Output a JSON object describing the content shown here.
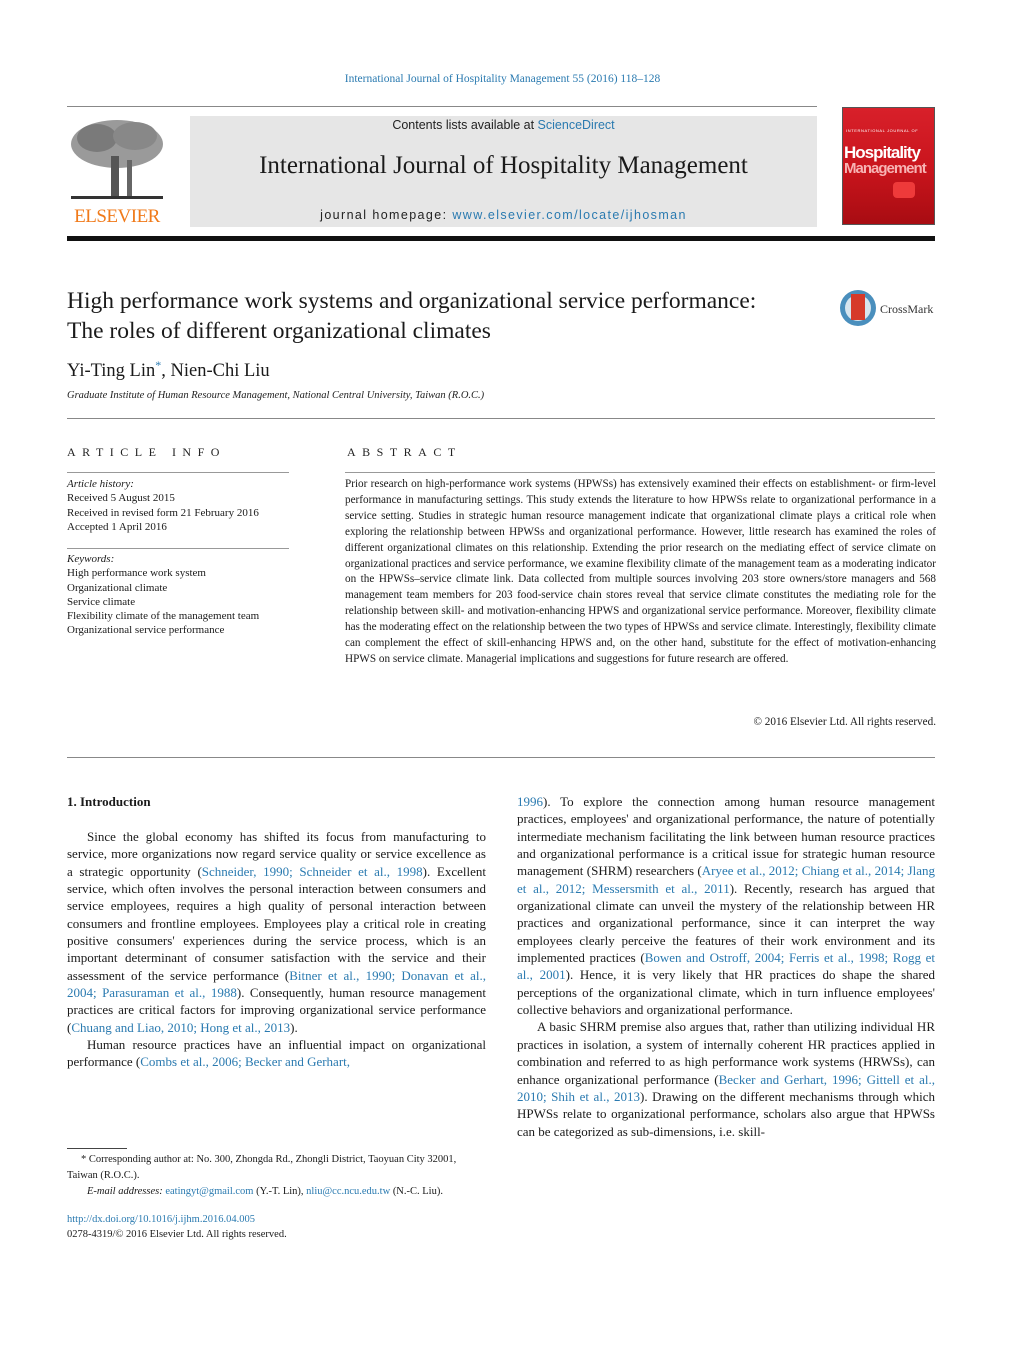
{
  "header": {
    "running_head": "International Journal of Hospitality Management 55 (2016) 118–128",
    "publisher_logo_text": "ELSEVIER",
    "contents_prefix": "Contents lists available at ",
    "contents_link": "ScienceDirect",
    "journal_title": "International Journal of Hospitality Management",
    "homepage_prefix": "journal homepage: ",
    "homepage_link": "www.elsevier.com/locate/ijhosman",
    "cover": {
      "top_line": "INTERNATIONAL JOURNAL OF",
      "word1": "Hospitality",
      "word2": "Management"
    },
    "colors": {
      "link": "#2a7ab0",
      "elsevier_orange": "#f07a1a",
      "cover_red": "#c8141c"
    }
  },
  "article": {
    "title": "High performance work systems and organizational service performance: The roles of different organizational climates",
    "crossmark_label": "CrossMark",
    "authors": [
      {
        "name": "Yi-Ting Lin",
        "marker": "*"
      },
      {
        "name": "Nien-Chi Liu",
        "marker": ""
      }
    ],
    "author_sep": ", ",
    "affiliation": "Graduate Institute of Human Resource Management, National Central University, Taiwan (R.O.C.)"
  },
  "article_info": {
    "heading": "ARTICLE INFO",
    "history_label": "Article history:",
    "history": [
      "Received 5 August 2015",
      "Received in revised form 21 February 2016",
      "Accepted 1 April 2016"
    ],
    "keywords_label": "Keywords:",
    "keywords": [
      "High performance work system",
      "Organizational climate",
      "Service climate",
      "Flexibility climate of the management team",
      "Organizational service performance"
    ]
  },
  "abstract": {
    "heading": "ABSTRACT",
    "text": "Prior research on high-performance work systems (HPWSs) has extensively examined their effects on establishment- or firm-level performance in manufacturing settings. This study extends the literature to how HPWSs relate to organizational performance in a service setting. Studies in strategic human resource management indicate that organizational climate plays a critical role when exploring the relationship between HPWSs and organizational performance. However, little research has examined the roles of different organizational climates on this relationship. Extending the prior research on the mediating effect of service climate on organizational practices and service performance, we examine flexibility climate of the management team as a moderating indicator on the HPWSs–service climate link. Data collected from multiple sources involving 203 store owners/store managers and 568 management team members for 203 food-service chain stores reveal that service climate constitutes the mediating role for the relationship between skill- and motivation-enhancing HPWS and organizational service performance. Moreover, flexibility climate has the moderating effect on the relationship between the two types of HPWSs and service climate. Interestingly, flexibility climate can complement the effect of skill-enhancing HPWS and, on the other hand, substitute for the effect of motivation-enhancing HPWS on service climate. Managerial implications and suggestions for future research are offered.",
    "copyright": "© 2016 Elsevier Ltd. All rights reserved."
  },
  "body": {
    "section_heading": "1.  Introduction",
    "left": {
      "p1": [
        "Since the global economy has shifted its focus from manufacturing to service, more organizations now regard service quality or service excellence as a strategic opportunity (",
        "Schneider, 1990; Schneider et al., 1998",
        "). Excellent service, which often involves the personal interaction between consumers and service employees, requires a high quality of personal interaction between consumers and frontline employees. Employees play a critical role in creating positive consumers' experiences during the service process, which is an important determinant of consumer satisfaction with the service and their assessment of the service performance (",
        "Bitner et al., 1990; Donavan et al., 2004; Parasuraman et al., 1988",
        "). Consequently, human resource management practices are critical factors for improving organizational service performance (",
        "Chuang and Liao, 2010; Hong et al., 2013",
        ")."
      ],
      "p2": [
        "Human resource practices have an influential impact on organizational performance (",
        "Combs et al., 2006; Becker and Gerhart,"
      ]
    },
    "right": {
      "p1": [
        "1996",
        "). To explore the connection among human resource management practices, employees' and organizational performance, the nature of potentially intermediate mechanism facilitating the link between human resource practices and organizational performance is a critical issue for strategic human resource management (SHRM) researchers (",
        "Aryee et al., 2012; Chiang et al., 2014; Jlang et al., 2012; Messersmith et al., 2011",
        "). Recently, research has argued that organizational climate can unveil the mystery of the relationship between HR practices and organizational performance, since it can interpret the way employees clearly perceive the features of their work environment and its implemented practices (",
        "Bowen and Ostroff, 2004; Ferris et al., 1998; Rogg et al., 2001",
        "). Hence, it is very likely that HR practices do shape the shared perceptions of the organizational climate, which in turn influence employees' collective behaviors and organizational performance."
      ],
      "p2": [
        "A basic SHRM premise also argues that, rather than utilizing individual HR practices in isolation, a system of internally coherent HR practices applied in combination and referred to as high performance work systems (HRWSs), can enhance organizational performance (",
        "Becker and Gerhart, 1996; Gittell et al., 2010; Shih et al., 2013",
        "). Drawing on the different mechanisms through which HPWSs relate to organizational performance, scholars also argue that HPWSs can be categorized as sub-dimensions, i.e. skill-"
      ]
    }
  },
  "footnote": {
    "marker": "*",
    "corresponding": " Corresponding author at: No. 300, Zhongda Rd., Zhongli District, Taoyuan City 32001, Taiwan (R.O.C.).",
    "email_label": "E-mail addresses: ",
    "email1": "eatingyt@gmail.com",
    "email1_owner": " (Y.-T. Lin), ",
    "email2": "nliu@cc.ncu.edu.tw",
    "email2_owner": " (N.-C. Liu).",
    "doi": "http://dx.doi.org/10.1016/j.ijhm.2016.04.005",
    "issn_line": "0278-4319/© 2016 Elsevier Ltd. All rights reserved."
  }
}
